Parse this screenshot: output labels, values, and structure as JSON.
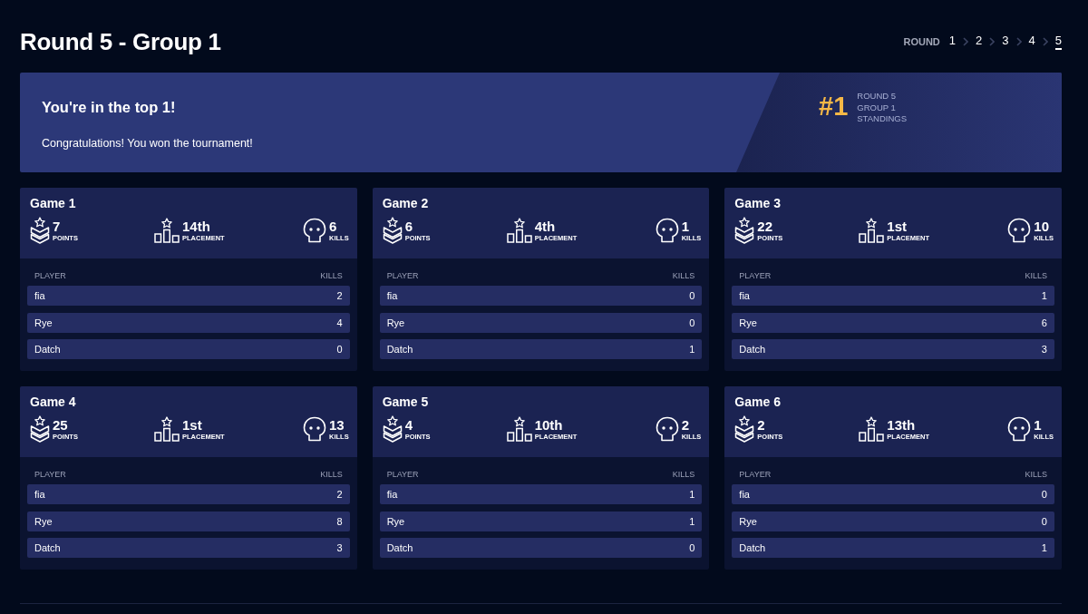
{
  "page": {
    "title": "Round 5 - Group 1"
  },
  "round_nav": {
    "label": "ROUND",
    "rounds": [
      {
        "label": "1",
        "selected": false
      },
      {
        "label": "2",
        "selected": false
      },
      {
        "label": "3",
        "selected": false
      },
      {
        "label": "4",
        "selected": false
      },
      {
        "label": "5",
        "selected": true
      }
    ]
  },
  "banner": {
    "heading": "You're in the top 1!",
    "message": "Congratulations! You won the tournament!",
    "rank": "#1",
    "rank_details": [
      "ROUND 5",
      "GROUP 1",
      "STANDINGS"
    ]
  },
  "games": [
    {
      "title": "Game 1",
      "stats": [
        {
          "kind": "points",
          "value": "7",
          "label": "POINTS"
        },
        {
          "kind": "placement",
          "value": "14th",
          "label": "PLACEMENT"
        },
        {
          "kind": "kills",
          "value": "6",
          "label": "KILLS"
        }
      ],
      "table": {
        "columns": [
          "PLAYER",
          "KILLS"
        ],
        "rows": [
          {
            "player": "fia",
            "kills": "2"
          },
          {
            "player": "Rye",
            "kills": "4"
          },
          {
            "player": "Datch",
            "kills": "0"
          }
        ]
      }
    },
    {
      "title": "Game 2",
      "stats": [
        {
          "kind": "points",
          "value": "6",
          "label": "POINTS"
        },
        {
          "kind": "placement",
          "value": "4th",
          "label": "PLACEMENT"
        },
        {
          "kind": "kills",
          "value": "1",
          "label": "KILLS"
        }
      ],
      "table": {
        "columns": [
          "PLAYER",
          "KILLS"
        ],
        "rows": [
          {
            "player": "fia",
            "kills": "0"
          },
          {
            "player": "Rye",
            "kills": "0"
          },
          {
            "player": "Datch",
            "kills": "1"
          }
        ]
      }
    },
    {
      "title": "Game 3",
      "stats": [
        {
          "kind": "points",
          "value": "22",
          "label": "POINTS"
        },
        {
          "kind": "placement",
          "value": "1st",
          "label": "PLACEMENT"
        },
        {
          "kind": "kills",
          "value": "10",
          "label": "KILLS"
        }
      ],
      "table": {
        "columns": [
          "PLAYER",
          "KILLS"
        ],
        "rows": [
          {
            "player": "fia",
            "kills": "1"
          },
          {
            "player": "Rye",
            "kills": "6"
          },
          {
            "player": "Datch",
            "kills": "3"
          }
        ]
      }
    },
    {
      "title": "Game 4",
      "stats": [
        {
          "kind": "points",
          "value": "25",
          "label": "POINTS"
        },
        {
          "kind": "placement",
          "value": "1st",
          "label": "PLACEMENT"
        },
        {
          "kind": "kills",
          "value": "13",
          "label": "KILLS"
        }
      ],
      "table": {
        "columns": [
          "PLAYER",
          "KILLS"
        ],
        "rows": [
          {
            "player": "fia",
            "kills": "2"
          },
          {
            "player": "Rye",
            "kills": "8"
          },
          {
            "player": "Datch",
            "kills": "3"
          }
        ]
      }
    },
    {
      "title": "Game 5",
      "stats": [
        {
          "kind": "points",
          "value": "4",
          "label": "POINTS"
        },
        {
          "kind": "placement",
          "value": "10th",
          "label": "PLACEMENT"
        },
        {
          "kind": "kills",
          "value": "2",
          "label": "KILLS"
        }
      ],
      "table": {
        "columns": [
          "PLAYER",
          "KILLS"
        ],
        "rows": [
          {
            "player": "fia",
            "kills": "1"
          },
          {
            "player": "Rye",
            "kills": "1"
          },
          {
            "player": "Datch",
            "kills": "0"
          }
        ]
      }
    },
    {
      "title": "Game 6",
      "stats": [
        {
          "kind": "points",
          "value": "2",
          "label": "POINTS"
        },
        {
          "kind": "placement",
          "value": "13th",
          "label": "PLACEMENT"
        },
        {
          "kind": "kills",
          "value": "1",
          "label": "KILLS"
        }
      ],
      "table": {
        "columns": [
          "PLAYER",
          "KILLS"
        ],
        "rows": [
          {
            "player": "fia",
            "kills": "0"
          },
          {
            "player": "Rye",
            "kills": "0"
          },
          {
            "player": "Datch",
            "kills": "1"
          }
        ]
      }
    }
  ]
}
